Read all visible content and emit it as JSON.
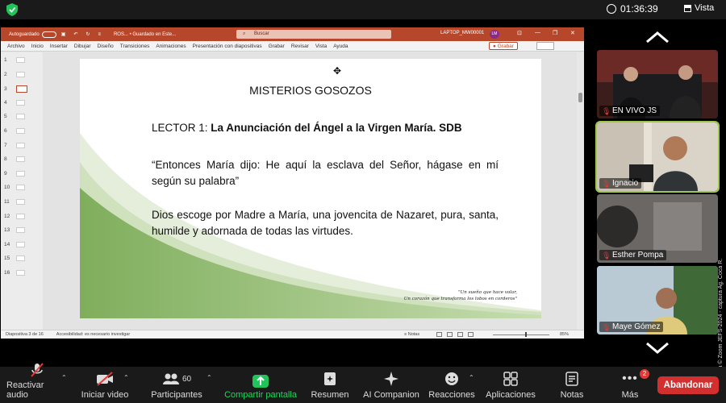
{
  "topbar": {
    "timer": "01:36:39",
    "view_label": "Vista"
  },
  "ppt": {
    "autosave_label": "Autoguardado",
    "doc_name": "ROS... • Guardado en Este...",
    "search_placeholder": "Buscar",
    "user": "LAPTOP_MW00001",
    "user_initials": "LM",
    "menu": [
      "Archivo",
      "Inicio",
      "Insertar",
      "Dibujar",
      "Diseño",
      "Transiciones",
      "Animaciones",
      "Presentación con diapositivas",
      "Grabar",
      "Revisar",
      "Vista",
      "Ayuda"
    ],
    "record_button": "Grabar",
    "slide_numbers": [
      "1",
      "2",
      "3",
      "4",
      "5",
      "6",
      "7",
      "8",
      "9",
      "10",
      "11",
      "12",
      "13",
      "14",
      "15",
      "16"
    ],
    "active_slide": 3,
    "status_slide": "Diapositiva 3 de 16",
    "status_accessibility": "Accesibilidad: es necesario investigar",
    "status_notes": "Notas",
    "zoom": "85%"
  },
  "slide": {
    "title": "MISTERIOS GOSOZOS",
    "lector_prefix": "LECTOR 1: ",
    "lector_bold": "La Anunciación del Ángel a la Virgen María. SDB",
    "quote": "“Entonces María dijo: He aquí la esclava del Señor, hágase en mí según su palabra”",
    "body": "Dios escoge por Madre a María, una jovencita de Nazaret, pura, santa, humilde y adornada de todas las virtudes.",
    "signature_line1": "\"Un sueño que hace volar,",
    "signature_line2": "Un corazón que transforma los lobos en corderos\"",
    "accent_color": "#8fb56a"
  },
  "participants": [
    {
      "name": "EN VIVO JS"
    },
    {
      "name": "Ignacio",
      "active": true
    },
    {
      "name": "Esther Pompa"
    },
    {
      "name": "Maye Gómez"
    }
  ],
  "watermark": "Cortesía © Zoom JEFS-2024 - captura Ag. Coca R.",
  "toolbar": {
    "mute_label": "Reactivar audio",
    "video_label": "Iniciar video",
    "participants_label": "Participantes",
    "participants_count": "60",
    "share_label": "Compartir pantalla",
    "summary_label": "Resumen",
    "companion_label": "AI Companion",
    "reactions_label": "Reacciones",
    "apps_label": "Aplicaciones",
    "notes_label": "Notas",
    "more_label": "Más",
    "more_badge": "2",
    "leave_label": "Abandonar"
  }
}
